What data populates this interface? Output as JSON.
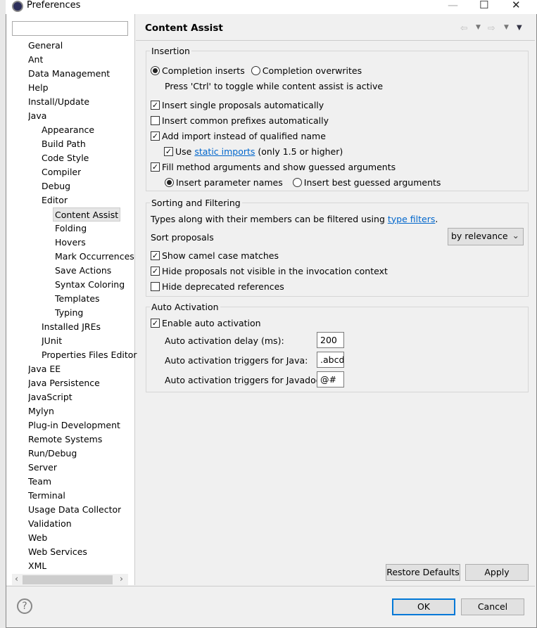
{
  "window": {
    "title": "Preferences",
    "minimize": "—",
    "maximize": "☐",
    "close": "✕"
  },
  "filter": {
    "value": "",
    "placeholder": ""
  },
  "tree": [
    {
      "label": "General",
      "level": 0
    },
    {
      "label": "Ant",
      "level": 0
    },
    {
      "label": "Data Management",
      "level": 0
    },
    {
      "label": "Help",
      "level": 0
    },
    {
      "label": "Install/Update",
      "level": 0
    },
    {
      "label": "Java",
      "level": 0
    },
    {
      "label": "Appearance",
      "level": 1
    },
    {
      "label": "Build Path",
      "level": 1
    },
    {
      "label": "Code Style",
      "level": 1
    },
    {
      "label": "Compiler",
      "level": 1
    },
    {
      "label": "Debug",
      "level": 1
    },
    {
      "label": "Editor",
      "level": 1
    },
    {
      "label": "Content Assist",
      "level": 2,
      "selected": true
    },
    {
      "label": "Folding",
      "level": 2
    },
    {
      "label": "Hovers",
      "level": 2
    },
    {
      "label": "Mark Occurrences",
      "level": 2
    },
    {
      "label": "Save Actions",
      "level": 2
    },
    {
      "label": "Syntax Coloring",
      "level": 2
    },
    {
      "label": "Templates",
      "level": 2
    },
    {
      "label": "Typing",
      "level": 2
    },
    {
      "label": "Installed JREs",
      "level": 1
    },
    {
      "label": "JUnit",
      "level": 1
    },
    {
      "label": "Properties Files Editor",
      "level": 1
    },
    {
      "label": "Java EE",
      "level": 0
    },
    {
      "label": "Java Persistence",
      "level": 0
    },
    {
      "label": "JavaScript",
      "level": 0
    },
    {
      "label": "Mylyn",
      "level": 0
    },
    {
      "label": "Plug-in Development",
      "level": 0
    },
    {
      "label": "Remote Systems",
      "level": 0
    },
    {
      "label": "Run/Debug",
      "level": 0
    },
    {
      "label": "Server",
      "level": 0
    },
    {
      "label": "Team",
      "level": 0
    },
    {
      "label": "Terminal",
      "level": 0
    },
    {
      "label": "Usage Data Collector",
      "level": 0
    },
    {
      "label": "Validation",
      "level": 0
    },
    {
      "label": "Web",
      "level": 0
    },
    {
      "label": "Web Services",
      "level": 0
    },
    {
      "label": "XML",
      "level": 0
    }
  ],
  "page": {
    "title": "Content Assist",
    "insertion": {
      "label": "Insertion",
      "radio1": "Completion inserts",
      "radio2": "Completion overwrites",
      "hint": "Press 'Ctrl' to toggle while content assist is active",
      "single": "Insert single proposals automatically",
      "common": "Insert common prefixes automatically",
      "addimport": "Add import instead of qualified name",
      "use": "Use",
      "static_link": "static imports",
      "only": "(only 1.5 or higher)",
      "fill": "Fill method arguments and show guessed arguments",
      "param_names": "Insert parameter names",
      "best_guess": "Insert best guessed arguments"
    },
    "sorting": {
      "label": "Sorting and Filtering",
      "types_text": "Types along with their members can be filtered using",
      "type_filters": "type filters",
      "sort_label": "Sort proposals",
      "sort_value": "by relevance",
      "camel": "Show camel case matches",
      "hide_proposals": "Hide proposals not visible in the invocation context",
      "hide_deprecated": "Hide deprecated references"
    },
    "auto": {
      "label": "Auto Activation",
      "enable": "Enable auto activation",
      "delay_label": "Auto activation delay (ms):",
      "delay": "200",
      "java_label": "Auto activation triggers for Java:",
      "java": ".abcd",
      "javadoc_label": "Auto activation triggers for Javadoc:",
      "javadoc": "@#"
    }
  },
  "buttons": {
    "restore": "Restore Defaults",
    "apply": "Apply",
    "ok": "OK",
    "cancel": "Cancel",
    "help": "?"
  }
}
